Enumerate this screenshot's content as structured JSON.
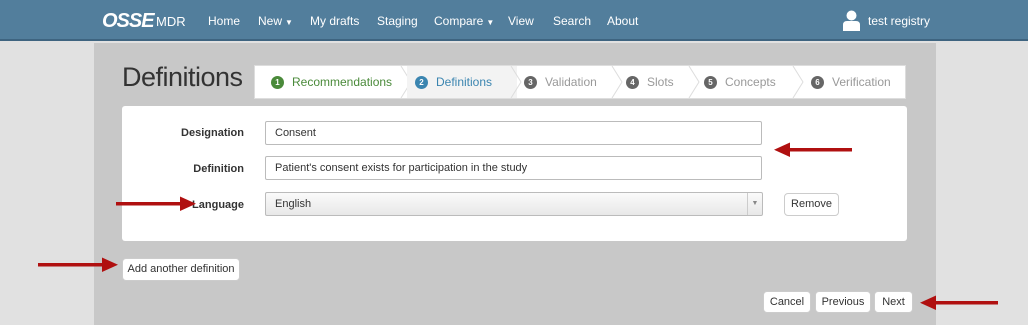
{
  "navbar": {
    "brand": "OSSE",
    "brand_sub": "MDR",
    "items": [
      "Home",
      "New",
      "My drafts",
      "Staging",
      "Compare",
      "View",
      "Search",
      "About"
    ],
    "user": "test registry",
    "user_icon": "user-icon"
  },
  "page": {
    "title": "Definitions"
  },
  "steps": [
    {
      "num": "1",
      "label": "Recommendations",
      "state": "done"
    },
    {
      "num": "2",
      "label": "Definitions",
      "state": "active"
    },
    {
      "num": "3",
      "label": "Validation",
      "state": "todo"
    },
    {
      "num": "4",
      "label": "Slots",
      "state": "todo"
    },
    {
      "num": "5",
      "label": "Concepts",
      "state": "todo"
    },
    {
      "num": "6",
      "label": "Verification",
      "state": "todo"
    }
  ],
  "form": {
    "designation_label": "Designation",
    "designation_value": "Consent",
    "definition_label": "Definition",
    "definition_value": "Patient's consent exists for participation in the study",
    "language_label": "Language",
    "language_value": "English",
    "remove_label": "Remove"
  },
  "actions": {
    "add_definition": "Add another definition",
    "cancel": "Cancel",
    "previous": "Previous",
    "next": "Next"
  },
  "colors": {
    "navbar": "#527e9c",
    "done": "#4a8a3a",
    "active": "#3b85b0",
    "annotation_arrow": "#b01010"
  }
}
